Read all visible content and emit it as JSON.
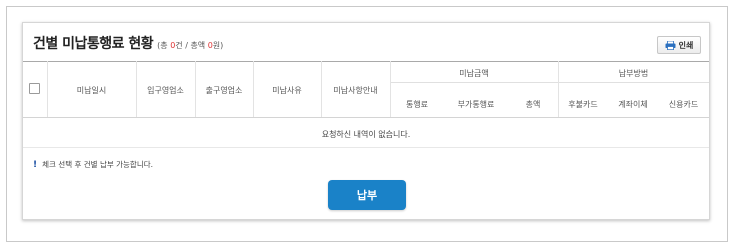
{
  "header": {
    "title": "건별 미납통행료 현황",
    "summary_prefix": "(총 ",
    "summary_count": "0",
    "summary_mid": "건 / 총액 ",
    "summary_amount": "0",
    "summary_suffix": "원)"
  },
  "toolbar": {
    "print_label": "인쇄"
  },
  "table": {
    "columns": {
      "unpaid_datetime": "미납일시",
      "entry_office": "입구영업소",
      "exit_office": "출구영업소",
      "unpaid_reason": "미납사유",
      "unpaid_guide": "미납사항안내",
      "unpaid_amount_group": "미납금액",
      "toll": "통행료",
      "surcharge": "부가통행료",
      "total": "총액",
      "payment_method_group": "납부방법",
      "postpaid_card": "후불카드",
      "bank_transfer": "계좌이체",
      "credit_card": "신용카드"
    },
    "empty_message": "요청하신 내역이 없습니다."
  },
  "notice": {
    "text": "체크 선택 후 건별 납부 가능합니다."
  },
  "actions": {
    "pay_label": "납부"
  },
  "colors": {
    "accent": "#1a82c8",
    "highlight_number": "#dd3333",
    "notice_icon": "#1a4fa3"
  }
}
